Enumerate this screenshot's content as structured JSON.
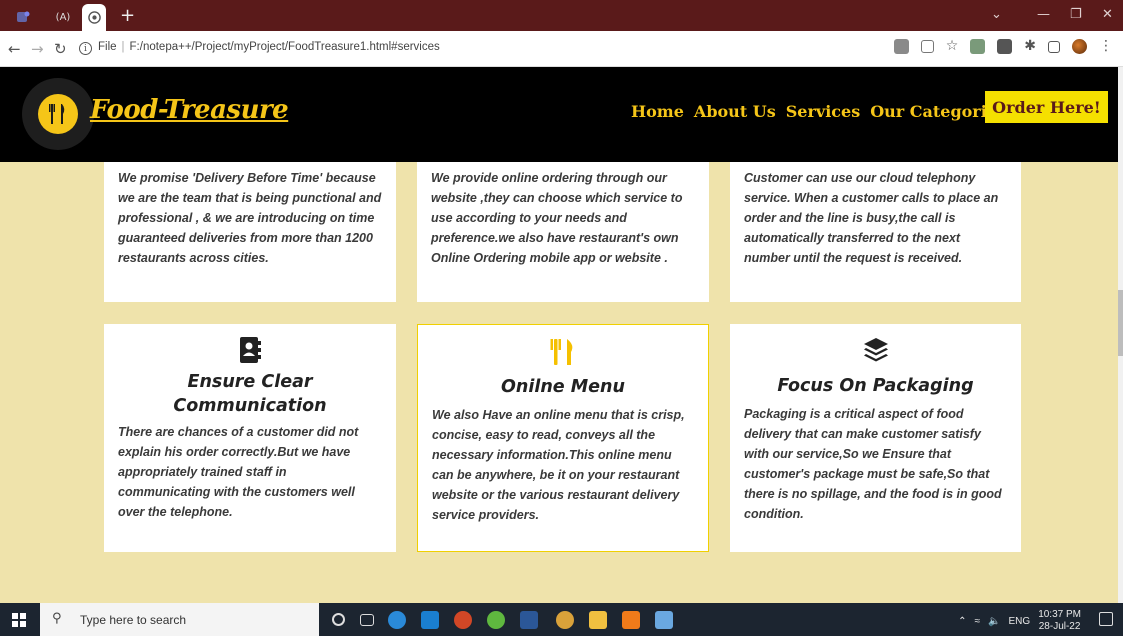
{
  "browser": {
    "tabs": [
      {
        "icon": "teams-icon",
        "label": ""
      },
      {
        "icon": "code-icon",
        "label": "(A)"
      },
      {
        "icon": "chrome-globe-icon",
        "label": ""
      }
    ],
    "new_tab_label": "+",
    "url_prefix": "File",
    "url": "F:/notepa++/Project/myProject/FoodTreasure1.html#services",
    "colors": {
      "tab_bar": "#5a1a1a"
    }
  },
  "site": {
    "brand": "Food-Treasure",
    "nav": [
      "Home",
      "About Us",
      "Services",
      "Our Categories"
    ],
    "order_button": "Order Here!",
    "colors": {
      "header_bg": "#000000",
      "accent": "#f5c518",
      "page_bg": "#efe3ab",
      "button_bg": "#f5e000"
    }
  },
  "services_top": [
    {
      "text": "We promise 'Delivery Before Time' because we are the team that is being punctional and professional , & we are introducing on time guaranteed deliveries from more than 1200 restaurants across cities."
    },
    {
      "text": "We provide online ordering through our website ,they can choose which service to use according to your needs and preference.we also have restaurant's own Online Ordering mobile app or website ."
    },
    {
      "text": "Customer can use our cloud telephony service. When a customer calls to place an order and the line is busy,the call is automatically transferred to the next number until the request is received."
    }
  ],
  "services_bottom": [
    {
      "icon": "contact-book-icon",
      "title": "Ensure Clear Communication",
      "text": "There are chances of a customer did not explain his order correctly.But we have appropriately trained staff in communicating with the customers well over the telephone."
    },
    {
      "icon": "utensils-icon",
      "title": "Onilne Menu",
      "text": "We also Have an online menu that is crisp, concise, easy to read, conveys all the necessary information.This online menu can be anywhere, be it on your restaurant website or the various restaurant delivery service providers."
    },
    {
      "icon": "layers-icon",
      "title": "Focus On Packaging",
      "text": "Packaging is a critical aspect of food delivery that can make customer satisfy with our service,So we Ensure that customer's package must be safe,So that there is no spillage, and the food is in good condition."
    }
  ],
  "taskbar": {
    "search_placeholder": "Type here to search",
    "language": "ENG",
    "time": "10:37 PM",
    "date": "28-Jul-22"
  }
}
